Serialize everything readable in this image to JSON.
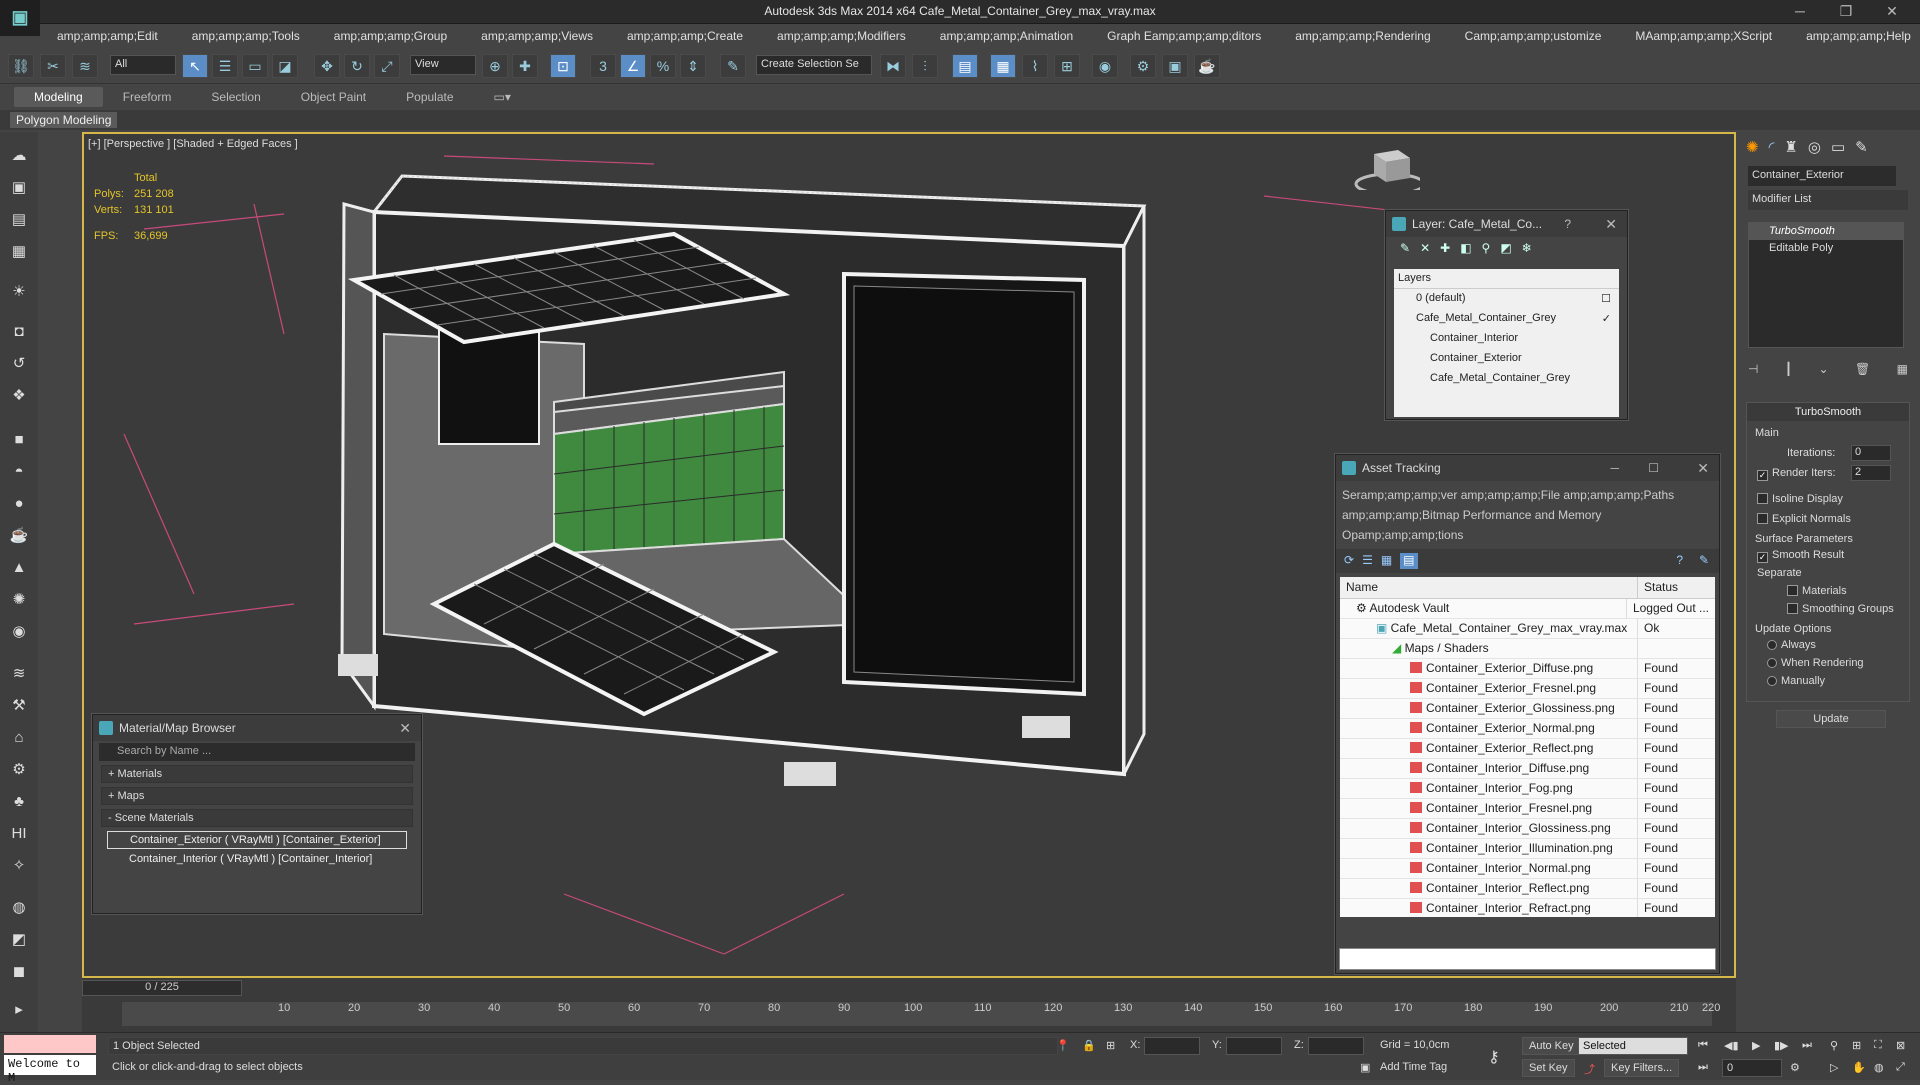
{
  "window": {
    "title": "Autodesk 3ds Max  2014 x64    Cafe_Metal_Container_Grey_max_vray.max",
    "logo": "3ds-max-logo"
  },
  "menu": [
    "amp;amp;amp;Edit",
    "amp;amp;amp;Tools",
    "amp;amp;amp;Group",
    "amp;amp;amp;Views",
    "amp;amp;amp;Create",
    "amp;amp;amp;Modifiers",
    "amp;amp;amp;Animation",
    "Graph Eamp;amp;amp;ditors",
    "amp;amp;amp;Rendering",
    "Camp;amp;amp;ustomize",
    "MAamp;amp;amp;XScript",
    "amp;amp;amp;Help"
  ],
  "toolbar": {
    "filter_select": "All",
    "view_select": "View",
    "selection_set_placeholder": "Create Selection Se"
  },
  "ribbon": {
    "tabs": [
      "Modeling",
      "Freeform",
      "Selection",
      "Object Paint",
      "Populate"
    ],
    "active_tab": "Modeling",
    "polygon_modeling": "Polygon Modeling"
  },
  "viewport": {
    "label": "[+] [Perspective ] [Shaded + Edged Faces ]",
    "stats": {
      "total_label": "Total",
      "polys_label": "Polys:",
      "polys_value": "251 208",
      "verts_label": "Verts:",
      "verts_value": "131 101",
      "fps_label": "FPS:",
      "fps_value": "36,699"
    },
    "accent_color": "#d6b84a",
    "stats_color": "#e3c42a"
  },
  "layer_panel": {
    "title": "Layer: Cafe_Metal_Co...",
    "help": "?",
    "header": "Layers",
    "rows": [
      {
        "label": "0 (default)",
        "mark": "☐"
      },
      {
        "label": "Cafe_Metal_Container_Grey",
        "mark": "✓"
      },
      {
        "label": "Container_Interior",
        "mark": ""
      },
      {
        "label": "Container_Exterior",
        "mark": ""
      },
      {
        "label": "Cafe_Metal_Container_Grey",
        "mark": ""
      }
    ]
  },
  "asset_panel": {
    "title": "Asset Tracking",
    "menu_line1": "Seramp;amp;amp;ver    amp;amp;amp;File    amp;amp;amp;Paths",
    "menu_line2": "amp;amp;amp;Bitmap Performance and Memory",
    "menu_line3": "Opamp;amp;amp;tions",
    "col_name": "Name",
    "col_status": "Status",
    "rows": [
      {
        "name": "Autodesk Vault",
        "status": "Logged Out ..."
      },
      {
        "name": "Cafe_Metal_Container_Grey_max_vray.max",
        "status": "Ok"
      },
      {
        "name": "Maps / Shaders",
        "status": ""
      },
      {
        "name": "Container_Exterior_Diffuse.png",
        "status": "Found"
      },
      {
        "name": "Container_Exterior_Fresnel.png",
        "status": "Found"
      },
      {
        "name": "Container_Exterior_Glossiness.png",
        "status": "Found"
      },
      {
        "name": "Container_Exterior_Normal.png",
        "status": "Found"
      },
      {
        "name": "Container_Exterior_Reflect.png",
        "status": "Found"
      },
      {
        "name": "Container_Interior_Diffuse.png",
        "status": "Found"
      },
      {
        "name": "Container_Interior_Fog.png",
        "status": "Found"
      },
      {
        "name": "Container_Interior_Fresnel.png",
        "status": "Found"
      },
      {
        "name": "Container_Interior_Glossiness.png",
        "status": "Found"
      },
      {
        "name": "Container_Interior_Illumination.png",
        "status": "Found"
      },
      {
        "name": "Container_Interior_Normal.png",
        "status": "Found"
      },
      {
        "name": "Container_Interior_Reflect.png",
        "status": "Found"
      },
      {
        "name": "Container_Interior_Refract.png",
        "status": "Found"
      }
    ]
  },
  "material_browser": {
    "title": "Material/Map Browser",
    "search_placeholder": "Search by Name ...",
    "sections": [
      "+ Materials",
      "+ Maps",
      "- Scene Materials"
    ],
    "items": [
      "Container_Exterior  ( VRayMtl )  [Container_Exterior]",
      "Container_Interior  ( VRayMtl )  [Container_Interior]"
    ]
  },
  "command_panel": {
    "object_name": "Container_Exterior",
    "modifier_list": "Modifier List",
    "stack": [
      "TurboSmooth",
      "Editable Poly"
    ],
    "turbosmooth": {
      "title": "TurboSmooth",
      "main": "Main",
      "iterations_label": "Iterations:",
      "iterations_value": "0",
      "render_iters_label": "Render Iters:",
      "render_iters_value": "2",
      "isoline": "Isoline Display",
      "explicit_normals": "Explicit Normals",
      "surface_params": "Surface Parameters",
      "smooth_result": "Smooth Result",
      "separate": "Separate",
      "materials": "Materials",
      "smoothing_groups": "Smoothing Groups",
      "update_options": "Update Options",
      "always": "Always",
      "when_rendering": "When Rendering",
      "manually": "Manually",
      "update_button": "Update"
    }
  },
  "timeline": {
    "slider_label": "0 / 225",
    "ticks": [
      "10",
      "20",
      "30",
      "40",
      "50",
      "60",
      "70",
      "80",
      "90",
      "100",
      "110",
      "120",
      "130",
      "140",
      "150",
      "160",
      "170",
      "180",
      "190",
      "200",
      "210",
      "220"
    ]
  },
  "status": {
    "welcome": "Welcome to M",
    "selected": "1 Object Selected",
    "prompt": "Click or click-and-drag to select objects",
    "x_label": "X:",
    "y_label": "Y:",
    "z_label": "Z:",
    "grid": "Grid = 10,0cm",
    "auto_key": "Auto Key",
    "set_key": "Set Key",
    "selected_select": "Selected",
    "key_filters": "Key Filters...",
    "add_time_tag": "Add Time Tag",
    "frame_value": "0"
  }
}
